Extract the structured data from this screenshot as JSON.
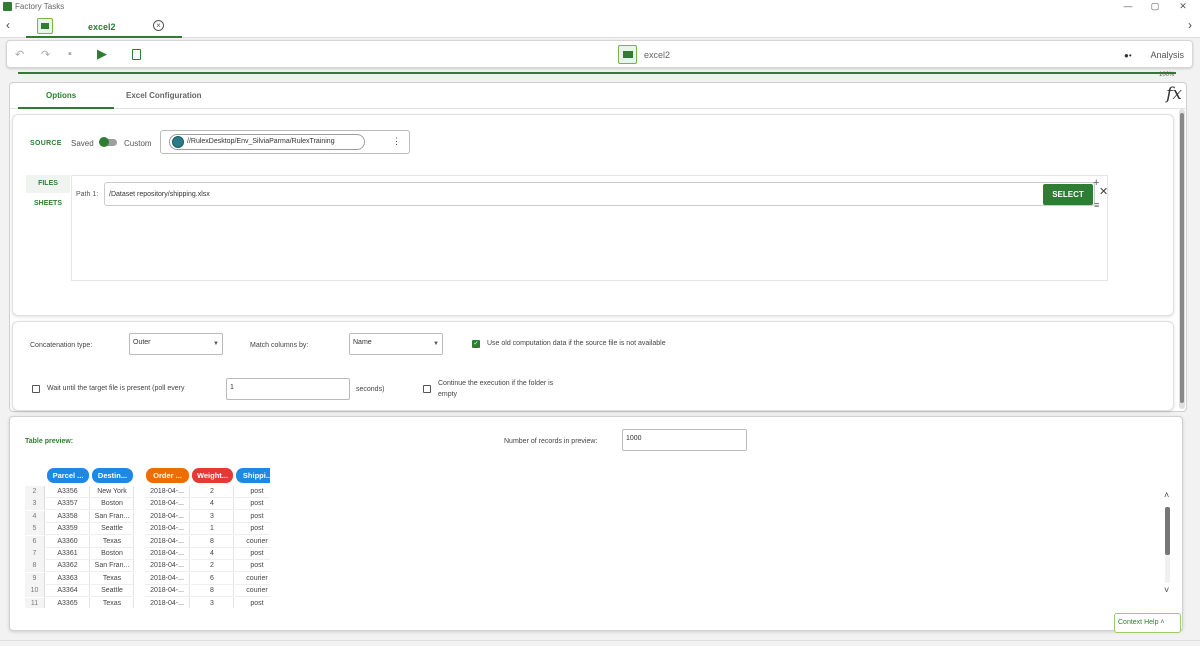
{
  "window": {
    "title": "Factory Tasks",
    "minimize": "—",
    "restore": "▢",
    "close": "✕"
  },
  "tabs": {
    "nav_left": "‹",
    "nav_right": "›",
    "active_label": "excel2",
    "close": "×"
  },
  "toolbar": {
    "undo": "↶",
    "redo": "↷",
    "save": "▪",
    "run": "▶",
    "center_label": "excel2",
    "analysis_label": "Analysis"
  },
  "progress": {
    "label": "100%",
    "value": 1.0
  },
  "subtabs": [
    "Options",
    "Excel Configuration"
  ],
  "fx_label": "fx",
  "source": {
    "label": "SOURCE",
    "saved": "Saved",
    "custom": "Custom",
    "path": "//RulexDesktop/Env_SilviaParma/RulexTraining",
    "menu": "⋮"
  },
  "side_tabs": [
    "FILES",
    "SHEETS"
  ],
  "files": {
    "path_label": "Path 1:",
    "path_value": "/Dataset repository/shipping.xlsx",
    "select_label": "SELECT",
    "clear": "✕",
    "add": "+",
    "list": "≡"
  },
  "options": {
    "concat_label": "Concatenation type:",
    "concat_value": "Outer",
    "match_label": "Match columns by:",
    "match_value": "Name",
    "use_old_label": "Use old computation data if the source file is not available",
    "use_old_checked": true,
    "wait_label": "Wait until the target file is present (poll every",
    "wait_value": "1",
    "seconds_label": "seconds)",
    "continue_label_1": "Continue the execution if the folder is",
    "continue_label_2": "empty"
  },
  "preview": {
    "title": "Table preview:",
    "records_label": "Number of records in preview:",
    "records_value": "1000",
    "columns": [
      {
        "label": "Parcel ...",
        "color": "#1e88e5"
      },
      {
        "label": "Destin...",
        "color": "#1e88e5"
      },
      {
        "label": "Order ...",
        "color": "#ef6c00"
      },
      {
        "label": "Weight...",
        "color": "#e53935"
      },
      {
        "label": "Shippi...",
        "color": "#1e88e5"
      }
    ],
    "rows": [
      [
        "2",
        "A3356",
        "New York",
        "2018-04-...",
        "2",
        "post"
      ],
      [
        "3",
        "A3357",
        "Boston",
        "2018-04-...",
        "4",
        "post"
      ],
      [
        "4",
        "A3358",
        "San Fran...",
        "2018-04-...",
        "3",
        "post"
      ],
      [
        "5",
        "A3359",
        "Seattle",
        "2018-04-...",
        "1",
        "post"
      ],
      [
        "6",
        "A3360",
        "Texas",
        "2018-04-...",
        "8",
        "courier"
      ],
      [
        "7",
        "A3361",
        "Boston",
        "2018-04-...",
        "4",
        "post"
      ],
      [
        "8",
        "A3362",
        "San Fran...",
        "2018-04-...",
        "2",
        "post"
      ],
      [
        "9",
        "A3363",
        "Texas",
        "2018-04-...",
        "6",
        "courier"
      ],
      [
        "10",
        "A3364",
        "Seattle",
        "2018-04-...",
        "8",
        "courier"
      ],
      [
        "11",
        "A3365",
        "Texas",
        "2018-04-...",
        "3",
        "post"
      ]
    ],
    "scroll_up": "˄",
    "scroll_down": "˅"
  },
  "context_help": "Context Help  ˄"
}
